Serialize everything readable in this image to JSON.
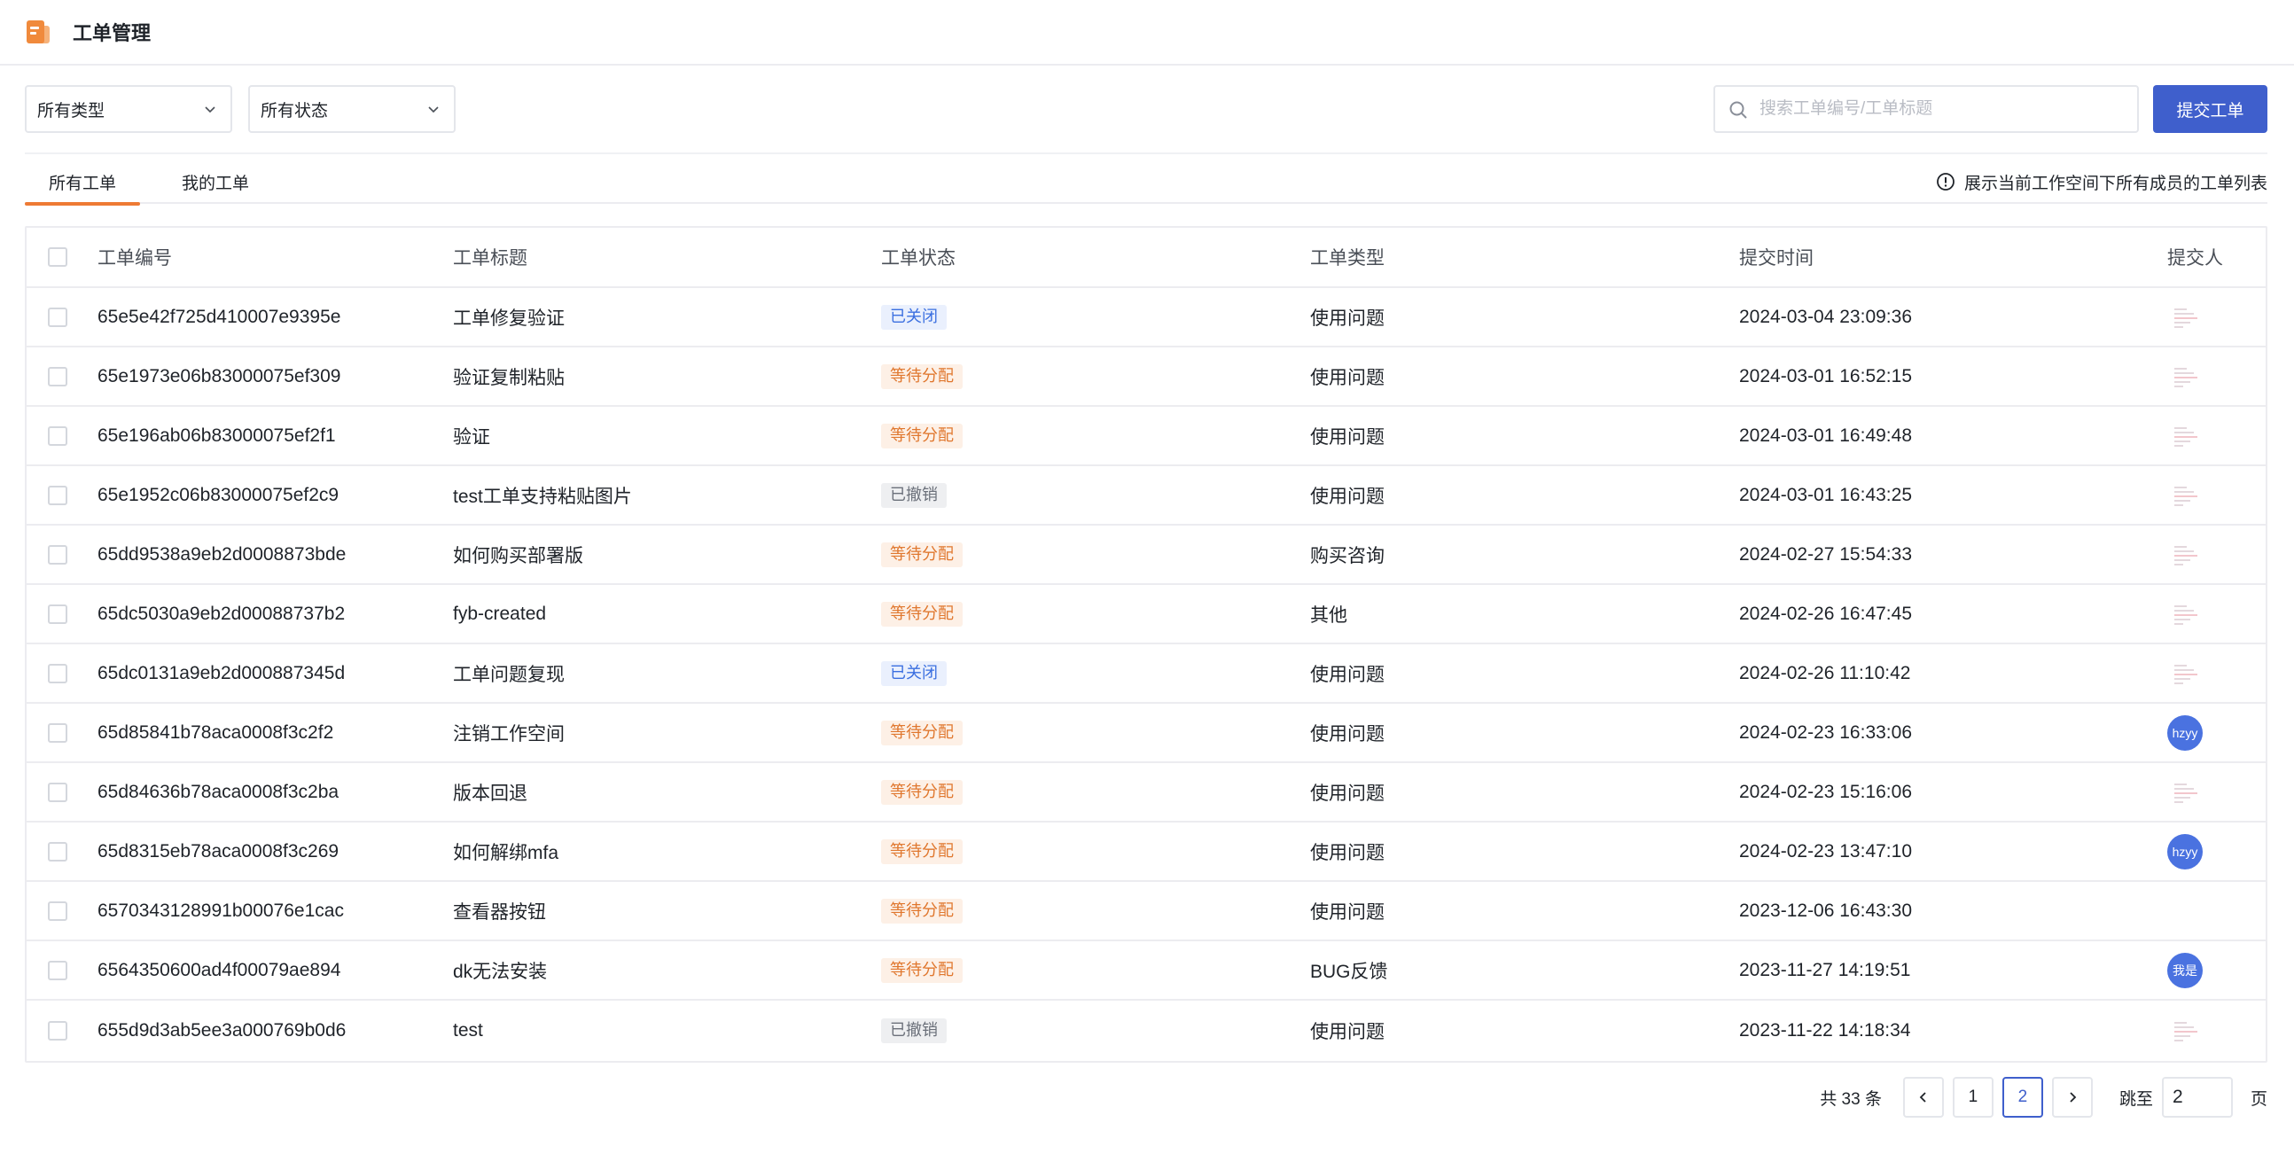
{
  "app": {
    "title": "工单管理"
  },
  "filters": {
    "type_select": "所有类型",
    "status_select": "所有状态",
    "search_placeholder": "搜索工单编号/工单标题",
    "search_value": "",
    "submit_label": "提交工单"
  },
  "tabs": {
    "items": [
      {
        "label": "所有工单",
        "active": true
      },
      {
        "label": "我的工单",
        "active": false
      }
    ],
    "hint": "展示当前工作空间下所有成员的工单列表"
  },
  "table": {
    "columns": [
      "工单编号",
      "工单标题",
      "工单状态",
      "工单类型",
      "提交时间",
      "提交人"
    ],
    "rows": [
      {
        "id": "65e5e42f725d410007e9395e",
        "title": "工单修复验证",
        "status": "已关闭",
        "status_kind": "closed",
        "type": "使用问题",
        "time": "2024-03-04 23:09:36",
        "user": {
          "kind": "thumb",
          "label": ""
        }
      },
      {
        "id": "65e1973e06b83000075ef309",
        "title": "验证复制粘贴",
        "status": "等待分配",
        "status_kind": "pending",
        "type": "使用问题",
        "time": "2024-03-01 16:52:15",
        "user": {
          "kind": "thumb",
          "label": ""
        }
      },
      {
        "id": "65e196ab06b83000075ef2f1",
        "title": "验证",
        "status": "等待分配",
        "status_kind": "pending",
        "type": "使用问题",
        "time": "2024-03-01 16:49:48",
        "user": {
          "kind": "thumb",
          "label": ""
        }
      },
      {
        "id": "65e1952c06b83000075ef2c9",
        "title": "test工单支持粘贴图片",
        "status": "已撤销",
        "status_kind": "revoked",
        "type": "使用问题",
        "time": "2024-03-01 16:43:25",
        "user": {
          "kind": "thumb",
          "label": ""
        }
      },
      {
        "id": "65dd9538a9eb2d0008873bde",
        "title": "如何购买部署版",
        "status": "等待分配",
        "status_kind": "pending",
        "type": "购买咨询",
        "time": "2024-02-27 15:54:33",
        "user": {
          "kind": "thumb",
          "label": ""
        }
      },
      {
        "id": "65dc5030a9eb2d00088737b2",
        "title": "fyb-created",
        "status": "等待分配",
        "status_kind": "pending",
        "type": "其他",
        "time": "2024-02-26 16:47:45",
        "user": {
          "kind": "thumb",
          "label": ""
        }
      },
      {
        "id": "65dc0131a9eb2d000887345d",
        "title": "工单问题复现",
        "status": "已关闭",
        "status_kind": "closed",
        "type": "使用问题",
        "time": "2024-02-26 11:10:42",
        "user": {
          "kind": "thumb",
          "label": ""
        }
      },
      {
        "id": "65d85841b78aca0008f3c2f2",
        "title": "注销工作空间",
        "status": "等待分配",
        "status_kind": "pending",
        "type": "使用问题",
        "time": "2024-02-23 16:33:06",
        "user": {
          "kind": "avatar",
          "label": "hzyy"
        }
      },
      {
        "id": "65d84636b78aca0008f3c2ba",
        "title": "版本回退",
        "status": "等待分配",
        "status_kind": "pending",
        "type": "使用问题",
        "time": "2024-02-23 15:16:06",
        "user": {
          "kind": "thumb",
          "label": ""
        }
      },
      {
        "id": "65d8315eb78aca0008f3c269",
        "title": "如何解绑mfa",
        "status": "等待分配",
        "status_kind": "pending",
        "type": "使用问题",
        "time": "2024-02-23 13:47:10",
        "user": {
          "kind": "avatar",
          "label": "hzyy"
        }
      },
      {
        "id": "6570343128991b00076e1cac",
        "title": "查看器按钮",
        "status": "等待分配",
        "status_kind": "pending",
        "type": "使用问题",
        "time": "2023-12-06 16:43:30",
        "user": {
          "kind": "none",
          "label": ""
        }
      },
      {
        "id": "6564350600ad4f00079ae894",
        "title": "dk无法安装",
        "status": "等待分配",
        "status_kind": "pending",
        "type": "BUG反馈",
        "time": "2023-11-27 14:19:51",
        "user": {
          "kind": "avatar",
          "label": "我是"
        }
      },
      {
        "id": "655d9d3ab5ee3a000769b0d6",
        "title": "test",
        "status": "已撤销",
        "status_kind": "revoked",
        "type": "使用问题",
        "time": "2023-11-22 14:18:34",
        "user": {
          "kind": "thumb",
          "label": ""
        }
      }
    ]
  },
  "pagination": {
    "total_text": "共 33 条",
    "pages": [
      "1",
      "2"
    ],
    "current": "2",
    "jump_label": "跳至",
    "jump_value": "2",
    "page_unit": "页"
  },
  "colors": {
    "primary": "#3f5fcc",
    "tab_accent": "#ee7a34",
    "closed": "#3b6fe0",
    "pending": "#e0772e",
    "revoked": "#6b707a"
  }
}
